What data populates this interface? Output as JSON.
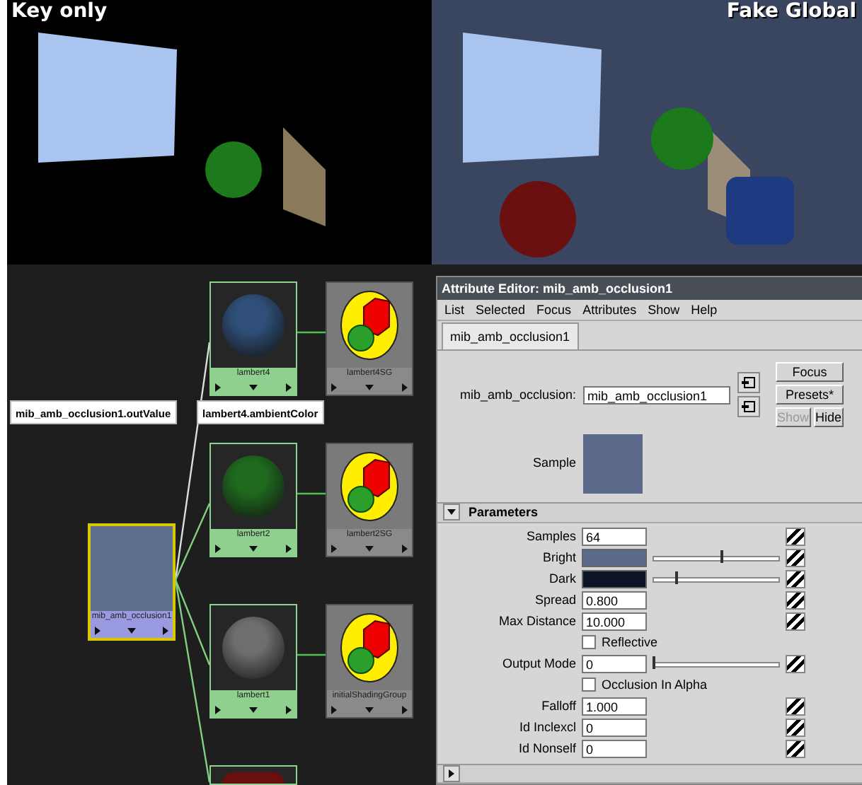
{
  "renders": [
    {
      "caption": "Key only",
      "kind": "key"
    },
    {
      "caption": "Fake Global",
      "kind": "global"
    }
  ],
  "node_editor": {
    "labels": [
      "mib_amb_occlusion1.outValue",
      "lambert4.ambientColor"
    ],
    "texture_node": {
      "name": "mib_amb_occlusion1",
      "selected": true,
      "color": "#5e6f8e"
    },
    "materials": [
      {
        "name": "lambert4",
        "color": "#2f4f78",
        "shading_group": "lambert4SG"
      },
      {
        "name": "lambert2",
        "color": "#1f6a1f",
        "shading_group": "lambert2SG"
      },
      {
        "name": "lambert1",
        "color": "#6e6e6e",
        "shading_group": "initialShadingGroup"
      },
      {
        "color": "#6a0e0e"
      }
    ]
  },
  "attribute_editor": {
    "title": "Attribute Editor: mib_amb_occlusion1",
    "menu": [
      "List",
      "Selected",
      "Focus",
      "Attributes",
      "Show",
      "Help"
    ],
    "tabs": [
      {
        "label": "mib_amb_occlusion1",
        "selected": true
      }
    ],
    "node_label": "mib_amb_occlusion:",
    "node_value": "mib_amb_occlusion1",
    "buttons": [
      "Focus",
      "Presets*"
    ],
    "show_hide": [
      {
        "label": "Show",
        "disabled": true
      },
      {
        "label": "Hide",
        "disabled": false
      }
    ],
    "sample": {
      "label": "Sample",
      "color": "#5b6a8a"
    },
    "section": {
      "title": "Parameters",
      "expanded": true
    },
    "params": [
      {
        "kind": "field",
        "label": "Samples",
        "value": "64"
      },
      {
        "kind": "color",
        "label": "Bright",
        "color": "#5b6a8a",
        "level": 0.55
      },
      {
        "kind": "color",
        "label": "Dark",
        "color": "#0b1424",
        "level": 0.18
      },
      {
        "kind": "field",
        "label": "Spread",
        "value": "0.800"
      },
      {
        "kind": "field",
        "label": "Max Distance",
        "value": "10.000"
      },
      {
        "kind": "checkbox",
        "label": "Reflective",
        "checked": false
      },
      {
        "kind": "slider",
        "label": "Output Mode",
        "value": "0",
        "level": 0
      },
      {
        "kind": "checkbox",
        "label": "Occlusion In Alpha",
        "checked": false
      },
      {
        "kind": "field",
        "label": "Falloff",
        "value": "1.000"
      },
      {
        "kind": "field",
        "label": "Id Inclexcl",
        "value": "0"
      },
      {
        "kind": "field",
        "label": "Id Nonself",
        "value": "0"
      }
    ],
    "next_section": {
      "expanded": false
    }
  }
}
